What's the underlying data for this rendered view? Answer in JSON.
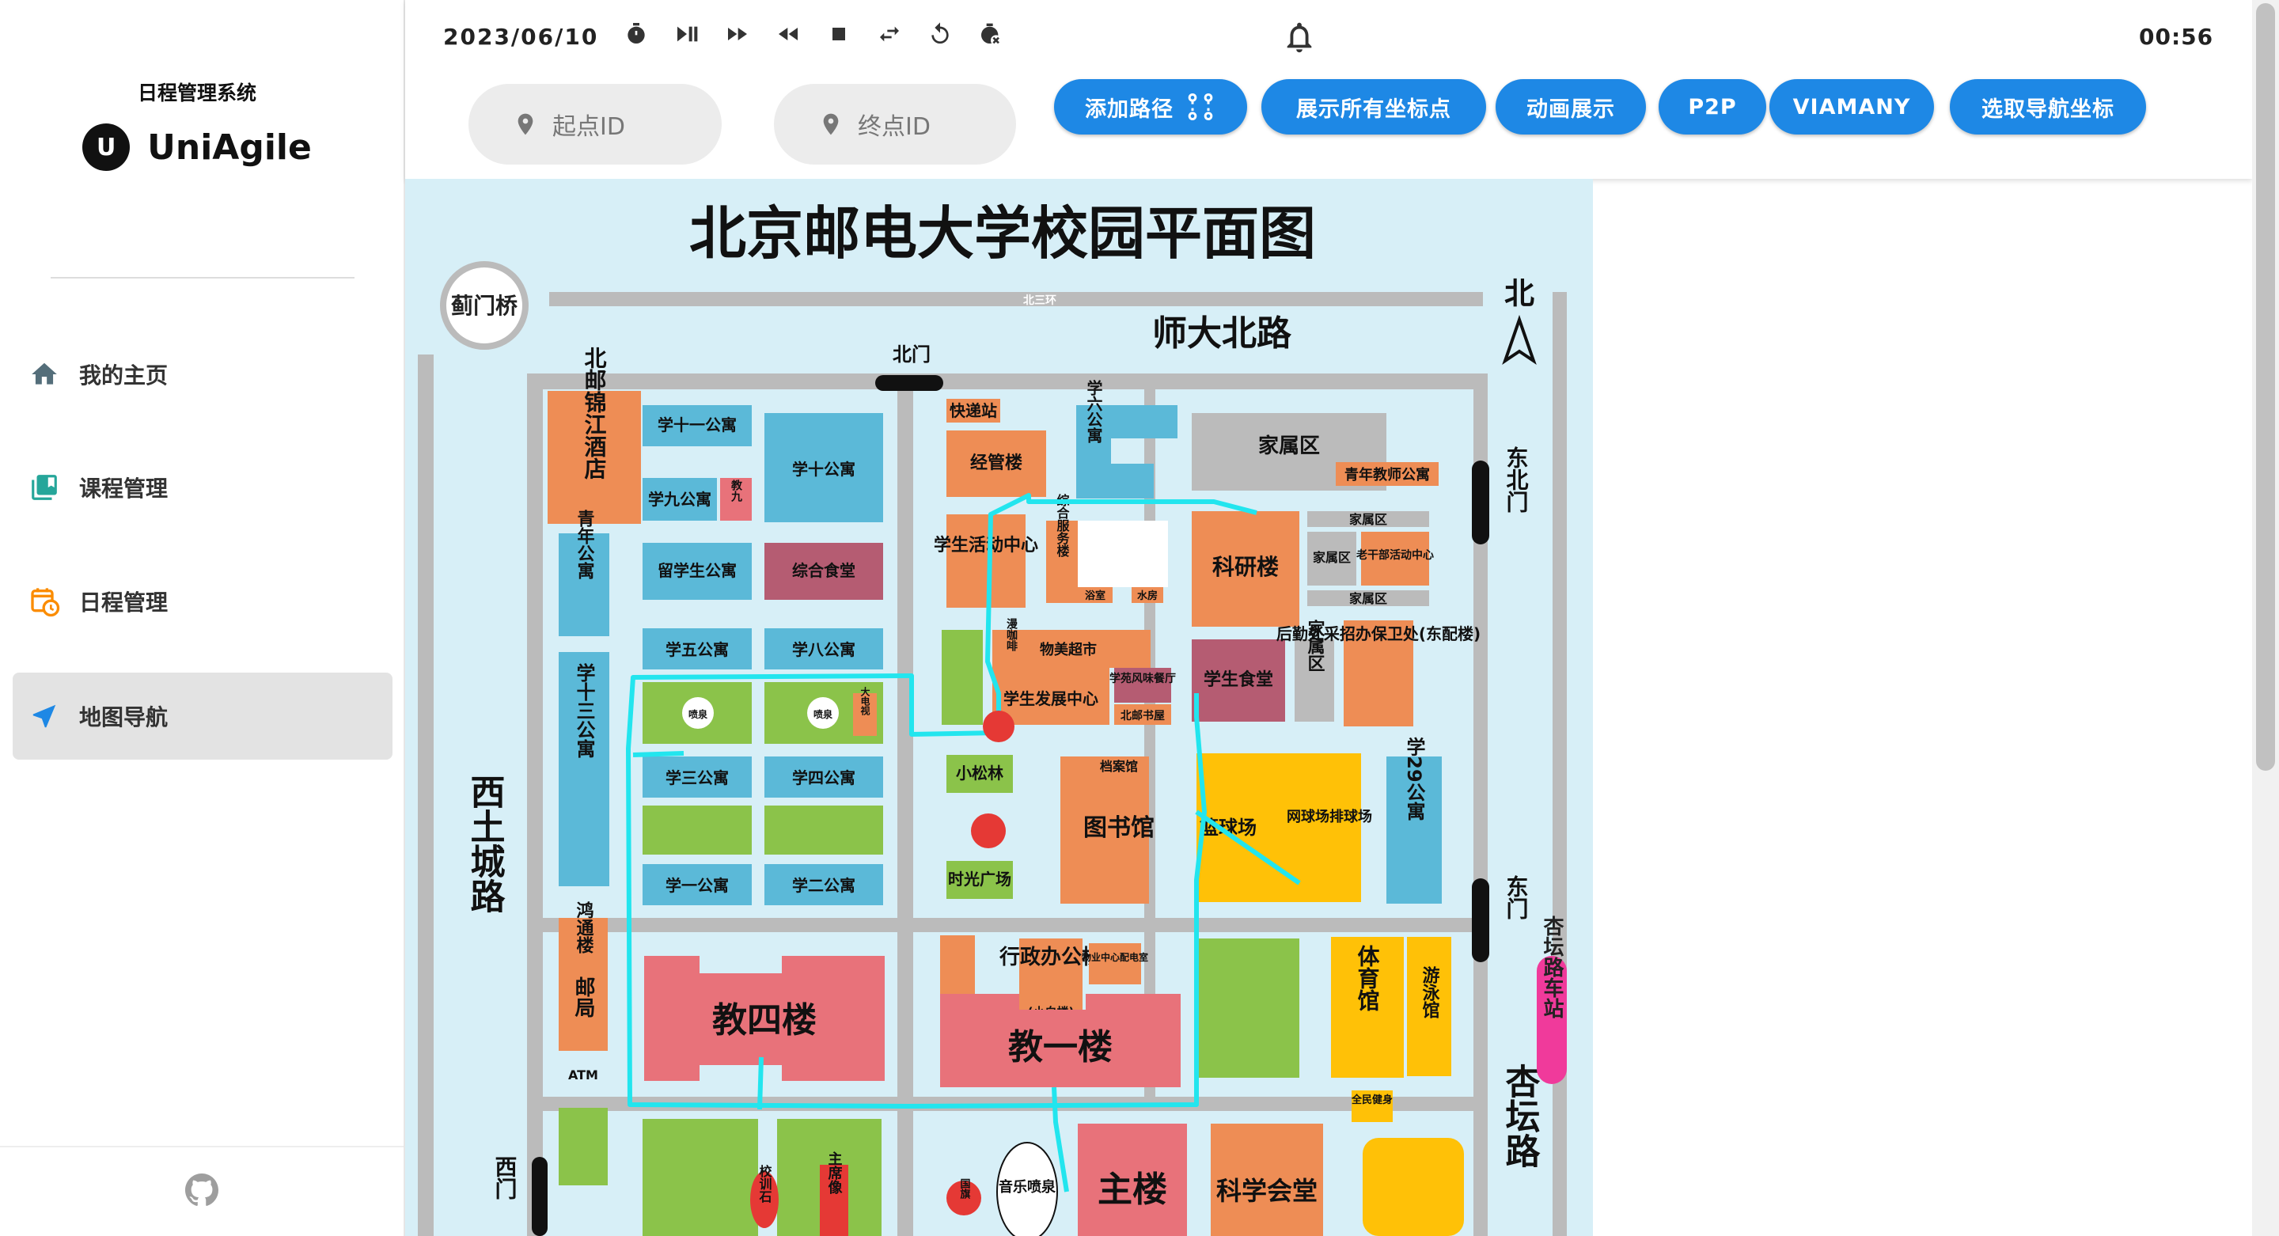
{
  "sidebar": {
    "system_name": "日程管理系统",
    "logo_letter": "U",
    "app_name": "UniAgile",
    "items": [
      {
        "label": "我的主页",
        "icon": "home-icon"
      },
      {
        "label": "课程管理",
        "icon": "book-icon"
      },
      {
        "label": "日程管理",
        "icon": "calendar-clock-icon"
      },
      {
        "label": "地图导航",
        "icon": "navigation-arrow-icon",
        "active": true
      }
    ],
    "footer_icon": "github-icon"
  },
  "toolbar": {
    "date": "2023/06/10",
    "clock": "00:56",
    "controls": [
      "timer-icon",
      "play-pause-icon",
      "fast-forward-icon",
      "rewind-icon",
      "stop-icon",
      "swap-icon",
      "replay-icon",
      "delete-timer-icon"
    ],
    "start_placeholder": "起点ID",
    "end_placeholder": "终点ID",
    "buttons": {
      "add_path": "添加路径",
      "show_all": "展示所有坐标点",
      "animate": "动画展示",
      "p2p": "P2P",
      "viamany": "VIAMANY",
      "pick_coords": "选取导航坐标"
    }
  },
  "map": {
    "title": "北京邮电大学校园平面图",
    "labels": {
      "jimen_bridge": "蓟门桥",
      "ring_road": "北三环",
      "north_gate": "北门",
      "shida_road": "师大北路",
      "north": "北",
      "northeast_gate": "东北门",
      "east_gate": "东门",
      "west_road": "西土城路",
      "west_gate": "西门",
      "xingtan_road": "杏坛路",
      "xingtan_station": "杏坛路车站"
    },
    "buildings": {
      "hotel": "北邮锦江酒店",
      "dorm11": "学十一公寓",
      "dorm10": "学十公寓",
      "dorm9": "学九公寓",
      "edu9": "教九",
      "international_dorm": "留学生公寓",
      "canteen_all": "综合食堂",
      "youth_dorm": "青年公寓",
      "dorm13": "学十三公寓",
      "dorm5": "学五公寓",
      "dorm8": "学八公寓",
      "fountain1": "喷泉",
      "fountain2": "喷泉",
      "big_tv": "大电视",
      "dorm3": "学三公寓",
      "dorm4": "学四公寓",
      "dorm1": "学一公寓",
      "dorm2": "学二公寓",
      "express": "快递站",
      "econ": "经管楼",
      "dorm6": "学六公寓",
      "student_center": "学生活动中心",
      "service": "综合服务楼",
      "bath": "浴室",
      "water": "水房",
      "family_area": "家属区",
      "young_teacher_dorm": "青年教师公寓",
      "research": "科研楼",
      "family2": "家属区",
      "family3": "家属区",
      "family4": "家属区",
      "elder_center": "老干部活动中心",
      "supermarket": "物美超市",
      "cafe": "漫咖啡",
      "dev_center": "学生发展中心",
      "flavor": "学苑风味餐厅",
      "bookstore": "北邮书屋",
      "student_canteen": "学生食堂",
      "family5": "家属区",
      "logistics": "后勤处采招办保卫处(东配楼)",
      "pine": "小松林",
      "archive": "档案馆",
      "library": "图书馆",
      "time_square": "时光广场",
      "basketball": "篮球场",
      "tennis": "网球场排球场",
      "dorm29": "学29公寓",
      "hongtong": "鸿通楼",
      "post": "邮局",
      "atm": "ATM",
      "edu4": "教四楼",
      "admin": "行政办公楼",
      "admin_sub": "(小白楼)",
      "property": "物业中心配电室",
      "edu1": "教一楼",
      "gym": "体育馆",
      "pool": "游泳馆",
      "fitness": "全民健身",
      "school_stone": "校训石",
      "chairman": "主席像",
      "flag": "国旗",
      "music_fountain": "音乐喷泉",
      "main_building": "主楼",
      "science_hall": "科学会堂"
    }
  },
  "colors": {
    "accent": "#1e88e5",
    "route": "#22e5ee",
    "map_bg": "#d7eff7",
    "orange_building": "#ee8d55",
    "blue_building": "#5bb9d8",
    "green_area": "#8bc34a",
    "pink_building": "#e8727a",
    "yellow_building": "#ffc107",
    "marker": "#e53935"
  }
}
